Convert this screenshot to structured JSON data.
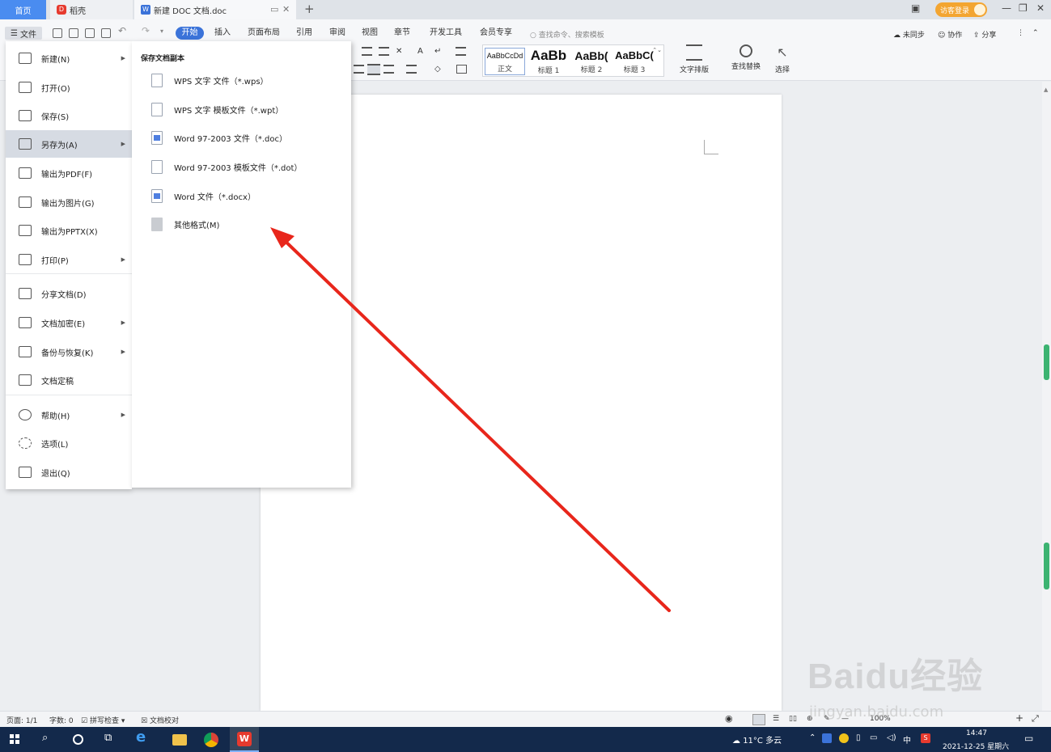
{
  "titlebar": {
    "home_tab": "首页",
    "daoke_tab": "稻壳",
    "doc_tab": "新建 DOC 文档.doc",
    "guest_login": "访客登录"
  },
  "menu_tabs": {
    "file": "文件",
    "start": "开始",
    "insert": "插入",
    "layout": "页面布局",
    "references": "引用",
    "review": "审阅",
    "view": "视图",
    "chapter": "章节",
    "devtools": "开发工具",
    "member": "会员专享",
    "search_placeholder": "查找命令、搜索模板",
    "unsynced": "未同步",
    "collab": "协作",
    "share": "分享"
  },
  "styles": [
    {
      "sample": "AaBbCcDd",
      "name": "正文"
    },
    {
      "sample": "AaBb",
      "name": "标题 1"
    },
    {
      "sample": "AaBb(",
      "name": "标题 2"
    },
    {
      "sample": "AaBbC(",
      "name": "标题 3"
    }
  ],
  "ribbon_tools": {
    "text_layout": "文字排版",
    "find_replace": "查找替换",
    "select": "选择"
  },
  "file_menu": [
    {
      "label": "新建(N)",
      "arrow": true
    },
    {
      "label": "打开(O)",
      "arrow": false
    },
    {
      "label": "保存(S)",
      "arrow": false
    },
    {
      "label": "另存为(A)",
      "arrow": true
    },
    {
      "label": "输出为PDF(F)",
      "arrow": false
    },
    {
      "label": "输出为图片(G)",
      "arrow": false
    },
    {
      "label": "输出为PPTX(X)",
      "arrow": false
    },
    {
      "label": "打印(P)",
      "arrow": true
    },
    {
      "label": "分享文档(D)",
      "arrow": false
    },
    {
      "label": "文档加密(E)",
      "arrow": true
    },
    {
      "label": "备份与恢复(K)",
      "arrow": true
    },
    {
      "label": "文档定稿",
      "arrow": false
    },
    {
      "label": "帮助(H)",
      "arrow": true
    },
    {
      "label": "选项(L)",
      "arrow": false
    },
    {
      "label": "退出(Q)",
      "arrow": false
    }
  ],
  "save_submenu": {
    "title": "保存文档副本",
    "items": [
      {
        "label": "WPS 文字 文件（*.wps）"
      },
      {
        "label": "WPS 文字 模板文件（*.wpt）"
      },
      {
        "label": "Word 97-2003 文件（*.doc）"
      },
      {
        "label": "Word 97-2003 模板文件（*.dot）"
      },
      {
        "label": "Word 文件（*.docx）"
      },
      {
        "label": "其他格式(M)"
      }
    ]
  },
  "statusbar": {
    "page": "页面: 1/1",
    "words": "字数: 0",
    "spellcheck": "拼写检查",
    "proofread": "文档校对",
    "zoom": "100%"
  },
  "taskbar": {
    "weather": "11°C 多云",
    "ime": "中",
    "time": "14:47",
    "date": "2021-12-25 星期六"
  },
  "watermark": {
    "brand": "Baidu经验",
    "url": "jingyan.baidu.com"
  },
  "colors": {
    "accent": "#3b73d9",
    "annotation_arrow": "#e8261b",
    "taskbar": "#13294b",
    "guest_button": "#f3a531"
  }
}
